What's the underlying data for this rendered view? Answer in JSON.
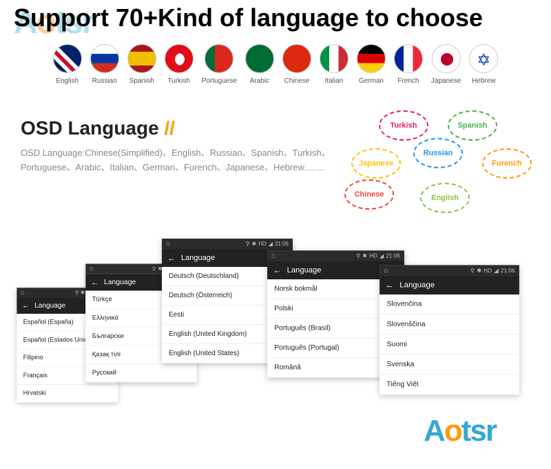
{
  "headline": "Support 70+Kind of language to choose",
  "logo": {
    "a": "A",
    "o": "o",
    "rest": "tsr"
  },
  "flags": [
    {
      "label": "English",
      "cls": "f-en"
    },
    {
      "label": "Russian",
      "cls": "f-ru"
    },
    {
      "label": "Spanish",
      "cls": "f-es"
    },
    {
      "label": "Turkish",
      "cls": "f-tr"
    },
    {
      "label": "Portuguese",
      "cls": "f-pt"
    },
    {
      "label": "Arabic",
      "cls": "f-ar"
    },
    {
      "label": "Chinese",
      "cls": "f-cn"
    },
    {
      "label": "Italian",
      "cls": "f-it"
    },
    {
      "label": "German",
      "cls": "f-de"
    },
    {
      "label": "French",
      "cls": "f-fr"
    },
    {
      "label": "Japanese",
      "cls": "f-jp"
    },
    {
      "label": "Hebrew",
      "cls": "f-he"
    }
  ],
  "osd": {
    "title_main": "OSD Language ",
    "title_slash": "//",
    "desc": "OSD Language:Chinese(Simplified)、English、Russian、Spanish、Turkish、Portuguese、Arabic、Italian、German、Furench、Japanese、Hebrew........"
  },
  "bubbles": [
    "Turkish",
    "Spanish",
    "Russian",
    "Furench",
    "Japanese",
    "Chinese",
    "English"
  ],
  "status": {
    "time": "21:06",
    "hd": "HD"
  },
  "screen_title": "Language",
  "screens": [
    [
      "Español (España)",
      "Español (Estados Unidos)",
      "Filipino",
      "Français",
      "Hrvatski"
    ],
    [
      "Türkçe",
      "Ελληνικά",
      "Български",
      "Қазақ тілі",
      "Русский"
    ],
    [
      "Deutsch (Deutschland)",
      "Deutsch (Österreich)",
      "Eesti",
      "English (United Kingdom)",
      "English (United States)"
    ],
    [
      "Norsk bokmål",
      "Polski",
      "Português (Brasil)",
      "Português (Portugal)",
      "Română"
    ],
    [
      "Slovenčina",
      "Slovenščina",
      "Suomi",
      "Svenska",
      "Tiếng Việt"
    ]
  ]
}
